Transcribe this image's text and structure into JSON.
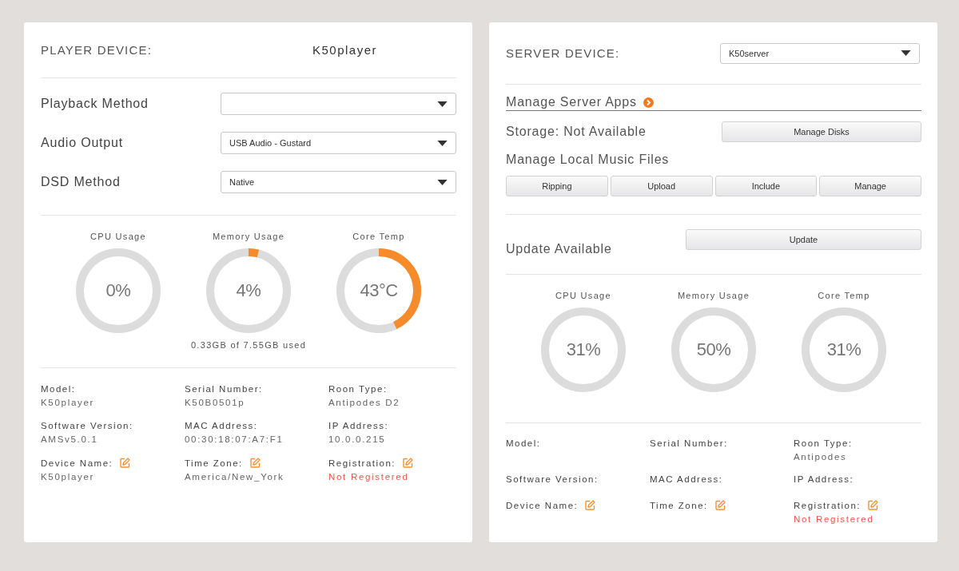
{
  "player": {
    "header": {
      "label": "PLAYER DEVICE:",
      "kind": "text",
      "value": "K50player"
    },
    "settings": [
      {
        "label": "Playback Method"
      },
      {
        "label": "Audio Output",
        "value": "USB Audio - Gustard"
      },
      {
        "label": "DSD Method",
        "value": "Native"
      }
    ],
    "gauges": [
      {
        "label": "CPU Usage",
        "reading": "0%",
        "level": 0
      },
      {
        "label": "Memory Usage",
        "reading": "4%",
        "level": 0.04,
        "caption": "0.33GB of 7.55GB used"
      },
      {
        "label": "Core Temp",
        "reading": "43°C",
        "level": 0.43
      }
    ],
    "info": [
      {
        "label": "Model:",
        "value": "K50player",
        "editable": false,
        "kind": "plain"
      },
      {
        "label": "Serial Number:",
        "value": "K50B0501p",
        "editable": false,
        "kind": "plain"
      },
      {
        "label": "Roon Type:",
        "value": "Antipodes D2",
        "editable": false,
        "kind": "plain"
      },
      {
        "label": "Software Version:",
        "value": "AMSv5.0.1",
        "editable": false,
        "kind": "plain"
      },
      {
        "label": "MAC Address:",
        "value": "00:30:18:07:A7:F1",
        "editable": false,
        "kind": "plain"
      },
      {
        "label": "IP Address:",
        "value": "10.0.0.215",
        "editable": false,
        "kind": "plain"
      },
      {
        "label": "Device Name:",
        "value": "K50player",
        "editable": true,
        "kind": "plain"
      },
      {
        "label": "Time Zone:",
        "value": "America/New_York",
        "editable": true,
        "kind": "plain"
      },
      {
        "label": "Registration:",
        "value": "Not Registered",
        "editable": true,
        "kind": "alert"
      }
    ]
  },
  "server": {
    "header": {
      "label": "SERVER DEVICE:",
      "kind": "select",
      "value": "K50server"
    },
    "apps_link": "Manage Server Apps",
    "storage": {
      "label": "Storage: Not Available",
      "button": "Manage Disks"
    },
    "music_files": {
      "heading": "Manage Local Music Files",
      "buttons": [
        "Ripping",
        "Upload",
        "Include",
        "Manage"
      ]
    },
    "update": {
      "label": "Update Available",
      "button": "Update"
    },
    "gauges": [
      {
        "label": "CPU Usage",
        "reading": "31%",
        "level": 0
      },
      {
        "label": "Memory Usage",
        "reading": "50%",
        "level": 0
      },
      {
        "label": "Core Temp",
        "reading": "31%",
        "level": 0
      }
    ],
    "info": [
      {
        "label": "Model:",
        "editable": false
      },
      {
        "label": "Serial Number:",
        "editable": false
      },
      {
        "label": "Roon Type:",
        "value": "Antipodes",
        "editable": false,
        "kind": "plain"
      },
      {
        "label": "Software Version:",
        "editable": false
      },
      {
        "label": "MAC Address:",
        "editable": false
      },
      {
        "label": "IP Address:",
        "editable": false
      },
      {
        "label": "Device Name:",
        "editable": true
      },
      {
        "label": "Time Zone:",
        "editable": true
      },
      {
        "label": "Registration:",
        "value": "Not Registered",
        "editable": true,
        "kind": "alert"
      }
    ]
  }
}
